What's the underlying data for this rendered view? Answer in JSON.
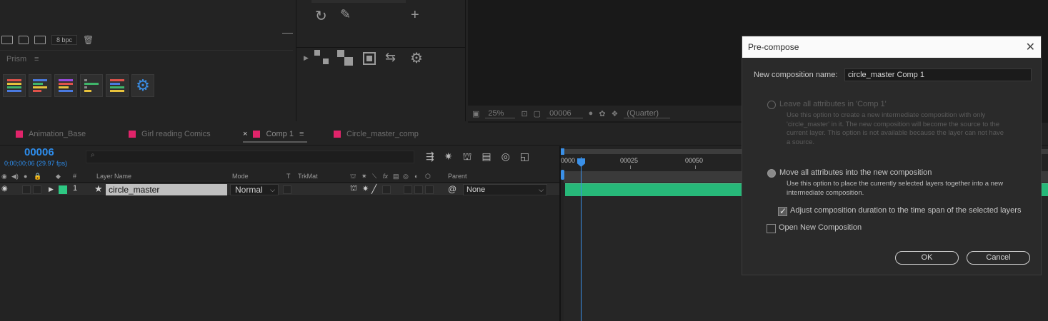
{
  "project": {
    "bpc_label": "8 bpc"
  },
  "prism": {
    "title": "Prism",
    "menu_glyph": "≡"
  },
  "viewer": {
    "zoom": "25%",
    "timecode": "00006",
    "resolution": "(Quarter)"
  },
  "tabs": [
    {
      "label": "Animation_Base",
      "active": false
    },
    {
      "label": "Girl reading Comics",
      "active": false
    },
    {
      "label": "Comp 1",
      "active": true
    },
    {
      "label": "Circle_master_comp",
      "active": false
    }
  ],
  "timeline": {
    "current_frame": "00006",
    "current_time": "0;00;00;06 (29.97 fps)",
    "columns": {
      "hash": "#",
      "layer_name": "Layer Name",
      "mode": "Mode",
      "t": "T",
      "trkmat": "TrkMat",
      "fx": "fx",
      "parent": "Parent"
    },
    "layers": [
      {
        "index": "1",
        "name": "circle_master",
        "mode": "Normal",
        "parent": "None",
        "label_color": "#2ec883"
      }
    ],
    "ruler": {
      "labels": [
        "0000",
        "00025",
        "00050"
      ]
    }
  },
  "dialog": {
    "title": "Pre-compose",
    "name_label": "New composition name:",
    "name_value": "circle_master Comp 1",
    "option1": {
      "label": "Leave all attributes in 'Comp 1'",
      "description_lines": [
        "Use this option to create a new intermediate composition with only",
        "'circle_master' in it. The new composition will become the source to the",
        "current layer. This option is not available because the layer can not have",
        "a source."
      ],
      "enabled": false,
      "selected": false
    },
    "option2": {
      "label": "Move all attributes into the new composition",
      "description_lines": [
        "Use this option to place the currently selected layers together into a new",
        "intermediate composition."
      ],
      "enabled": true,
      "selected": true
    },
    "adjust_duration": {
      "label": "Adjust composition duration to the time span of the selected layers",
      "checked": true
    },
    "open_new": {
      "label": "Open New Composition",
      "checked": false
    },
    "ok_label": "OK",
    "cancel_label": "Cancel"
  },
  "colors": {
    "accent_blue": "#2d8ceb",
    "tab_swatch": "#e0246a",
    "clip_green": "#27b879"
  }
}
